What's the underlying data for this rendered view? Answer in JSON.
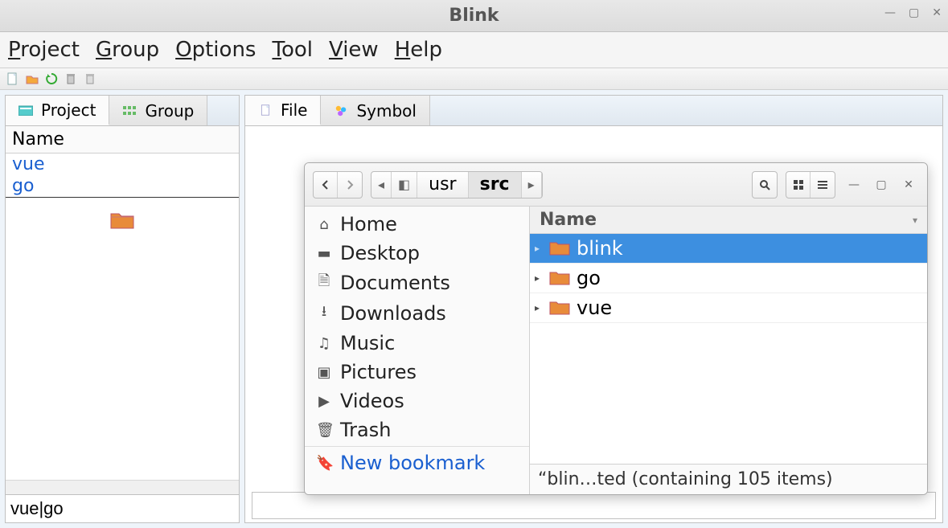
{
  "window": {
    "title": "Blink"
  },
  "menubar": {
    "items": [
      {
        "label": "Project",
        "accel": "P"
      },
      {
        "label": "Group",
        "accel": "G"
      },
      {
        "label": "Options",
        "accel": "O"
      },
      {
        "label": "Tool",
        "accel": "T"
      },
      {
        "label": "View",
        "accel": "V"
      },
      {
        "label": "Help",
        "accel": "H"
      }
    ]
  },
  "toolbar_icons": [
    "new",
    "open",
    "refresh",
    "delete",
    "trash"
  ],
  "left": {
    "tabs": {
      "project": "Project",
      "group": "Group"
    },
    "column_header": "Name",
    "projects": [
      "vue",
      "go"
    ],
    "input_value": "vue|go"
  },
  "right": {
    "tabs": {
      "file": "File",
      "symbol": "Symbol"
    }
  },
  "fm": {
    "path": {
      "seg1": "usr",
      "seg2": "src"
    },
    "sidebar": {
      "home": "Home",
      "desktop": "Desktop",
      "documents": "Documents",
      "downloads": "Downloads",
      "music": "Music",
      "pictures": "Pictures",
      "videos": "Videos",
      "trash": "Trash",
      "new_bookmark": "New bookmark"
    },
    "col_header": "Name",
    "rows": [
      {
        "name": "blink",
        "selected": true
      },
      {
        "name": "go",
        "selected": false
      },
      {
        "name": "vue",
        "selected": false
      }
    ],
    "status": "“blin…ted (containing 105 items)"
  }
}
